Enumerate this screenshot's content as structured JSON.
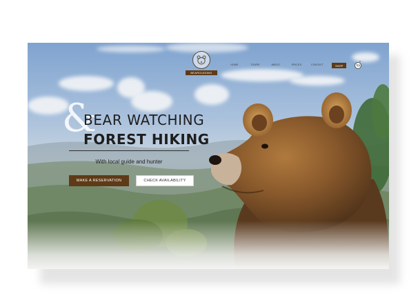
{
  "brand": {
    "logo_text": "BEARGUIDING"
  },
  "nav": {
    "items": [
      "HOME",
      "TOURS",
      "ABOUT",
      "PRICES",
      "CONTACT"
    ],
    "shop_label": "SHOP",
    "cart_count": "0"
  },
  "hero": {
    "ampersand": "&",
    "title_line1": "BEAR WATCHING",
    "title_line2": "FOREST HIKING",
    "subtitle": "With local guide and hunter",
    "reserve_label": "MAKE A RESERVATION",
    "availability_label": "CHECK AVAILABILITY"
  },
  "colors": {
    "accent": "#5e3a17",
    "text": "#1e1e1e"
  }
}
